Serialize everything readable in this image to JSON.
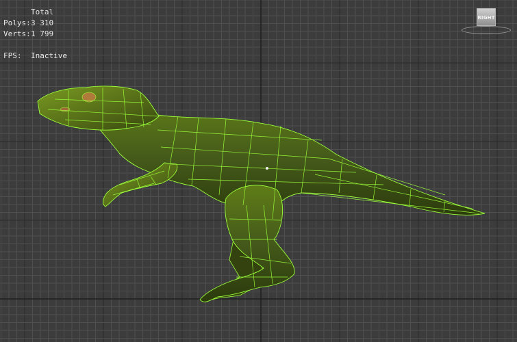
{
  "viewport": {
    "stats": {
      "header": "Total",
      "polys_label": "Polys:",
      "polys_value": "3 310",
      "verts_label": "Verts:",
      "verts_value": "1 799",
      "fps_label": "FPS:",
      "fps_value": "Inactive"
    },
    "viewcube": {
      "face_label": "RIGHT"
    },
    "colors": {
      "background": "#3c3c3c",
      "grid_minor": "#4f4f4f",
      "grid_major": "#1e1e1e",
      "wireframe": "#9cff3a",
      "skin_dark": "#2f3d0e",
      "skin_light": "#6f8f1c"
    }
  }
}
